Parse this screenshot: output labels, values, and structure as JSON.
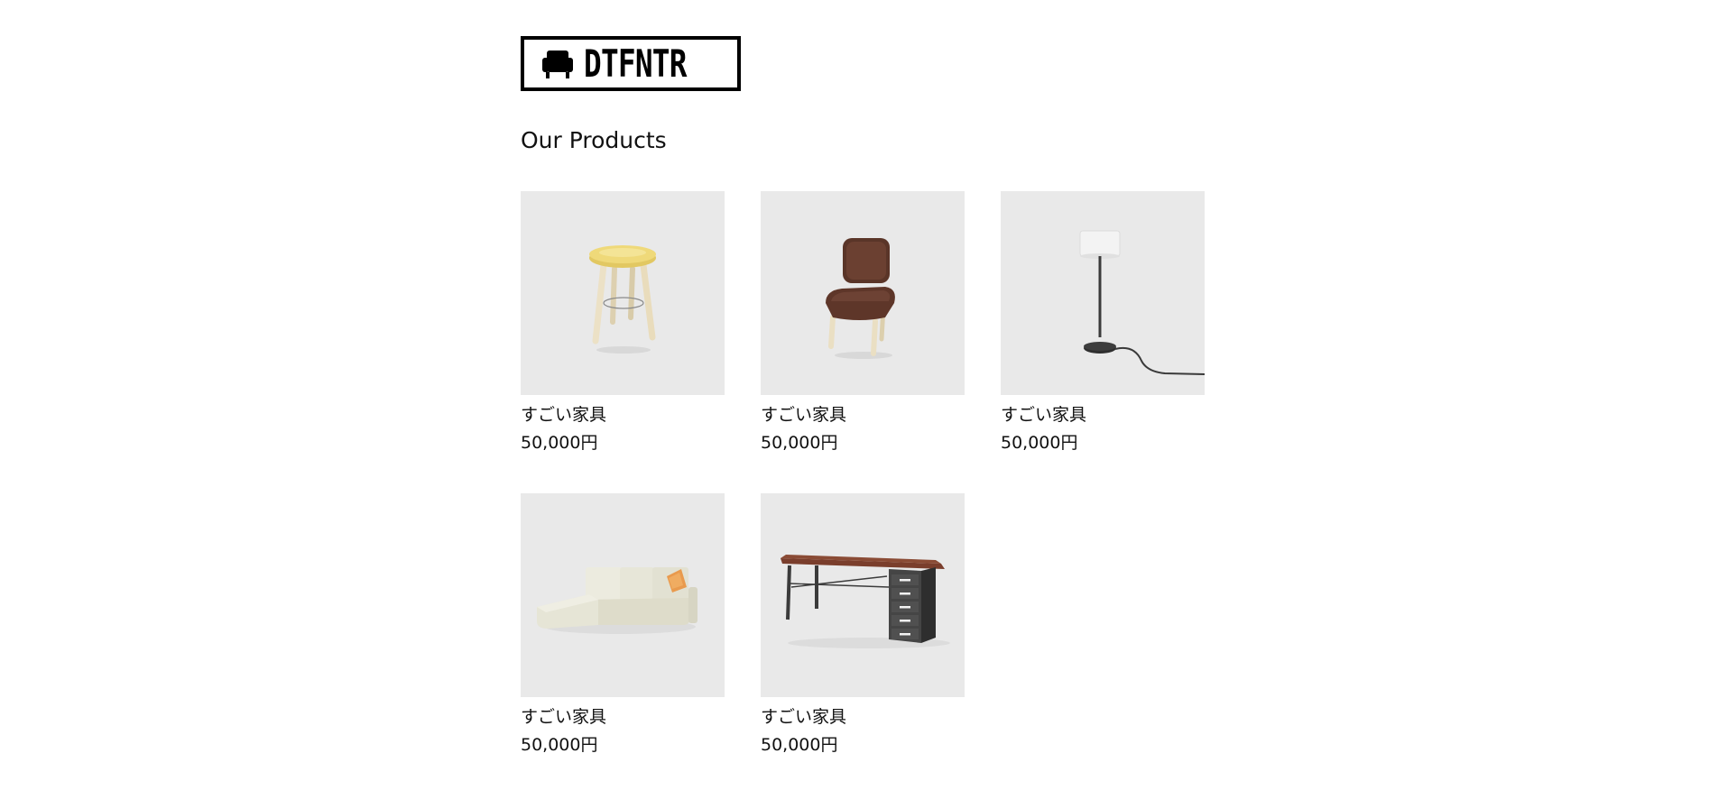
{
  "header": {
    "logo_text": "DTFNTR",
    "logo_icon": "armchair-icon"
  },
  "main": {
    "heading": "Our Products",
    "products": [
      {
        "name": "すごい家具",
        "price": "50,000円",
        "image": "stool-image"
      },
      {
        "name": "すごい家具",
        "price": "50,000円",
        "image": "chair-image"
      },
      {
        "name": "すごい家具",
        "price": "50,000円",
        "image": "floor-lamp-image"
      },
      {
        "name": "すごい家具",
        "price": "50,000円",
        "image": "sofa-image"
      },
      {
        "name": "すごい家具",
        "price": "50,000円",
        "image": "desk-image"
      }
    ]
  },
  "colors": {
    "background": "#ffffff",
    "thumbnail_bg": "#e9e9e9",
    "text": "#111111",
    "logo": "#000000"
  }
}
